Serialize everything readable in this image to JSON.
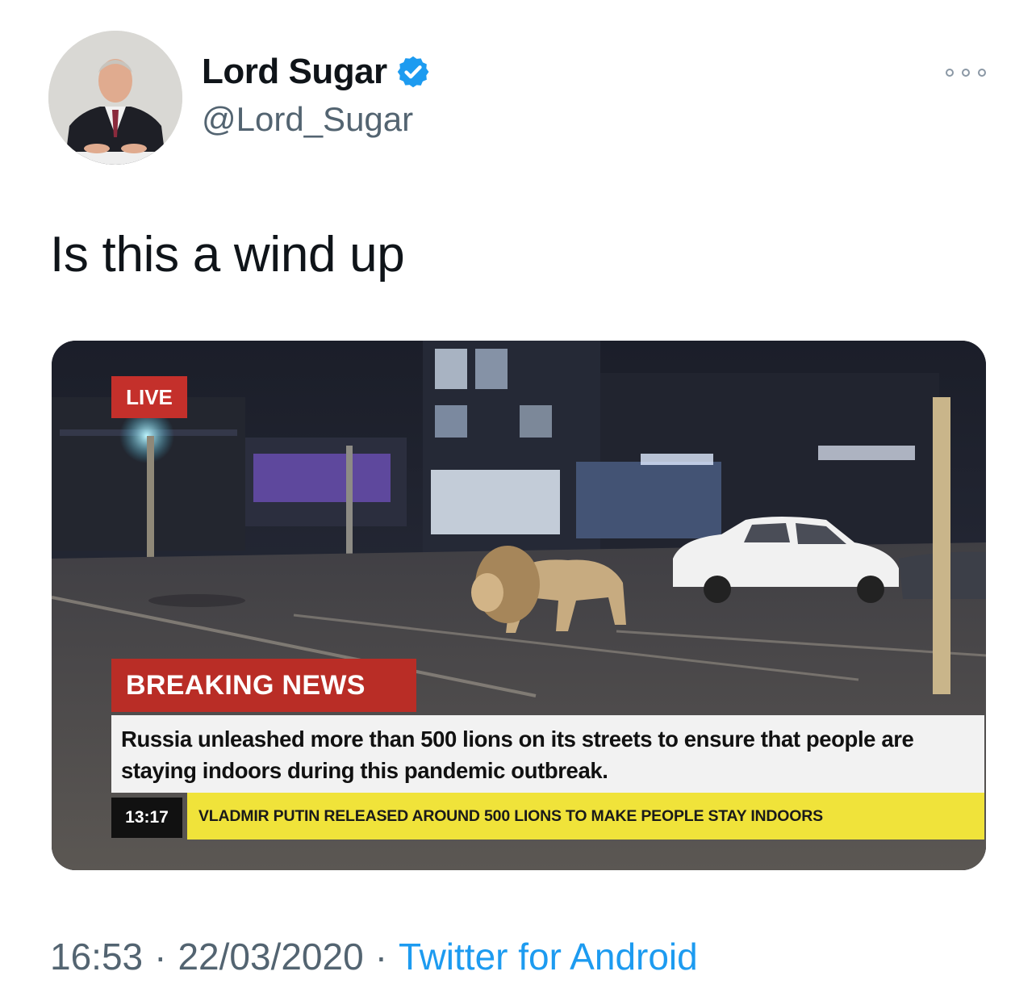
{
  "author": {
    "display_name": "Lord Sugar",
    "handle": "@Lord_Sugar",
    "verified": true
  },
  "tweet": {
    "text": "Is this a wind up"
  },
  "media": {
    "live_label": "LIVE",
    "breaking_label": "BREAKING NEWS",
    "headline": "Russia unleashed more than 500 lions on its streets to ensure that people are staying indoors during this pandemic outbreak.",
    "ticker_time": "13:17",
    "ticker_text": "VLADMIR PUTIN RELEASED AROUND 500 LIONS TO MAKE PEOPLE STAY INDOORS"
  },
  "footer": {
    "time": "16:53",
    "separator": "·",
    "date": "22/03/2020",
    "source": "Twitter for Android"
  },
  "colors": {
    "verified_badge": "#1d9bf0",
    "link": "#1d9bf0",
    "secondary_text": "#536471",
    "live_red": "#c4302b",
    "ticker_yellow": "#f0e33a"
  },
  "icons": {
    "verified": "verified-badge-icon",
    "more": "more-options-icon"
  }
}
